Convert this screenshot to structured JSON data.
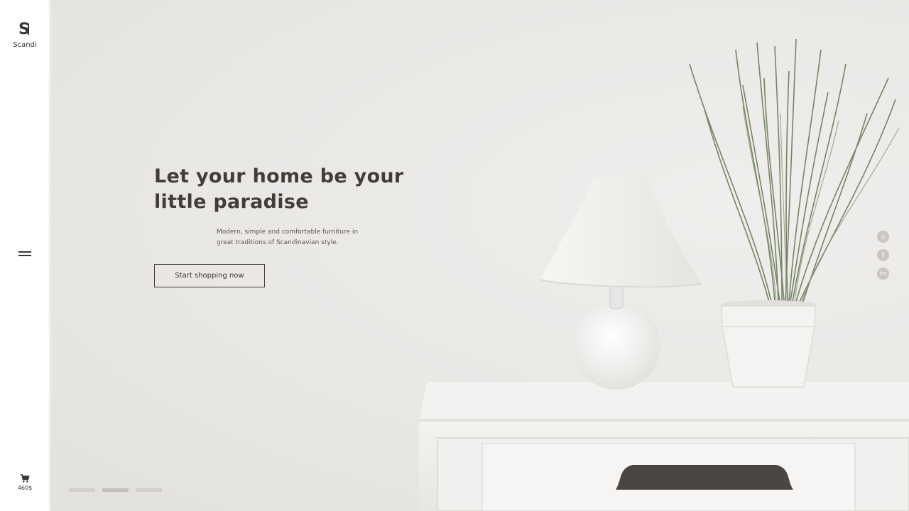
{
  "brand": {
    "name": "Scandi",
    "mark": "S"
  },
  "cart": {
    "total": "460$",
    "icon": "cart-icon"
  },
  "menu": {
    "icon": "hamburger-menu-icon"
  },
  "hero": {
    "headline_line1": "Let your home be your",
    "headline_line2": "little paradise",
    "subtext_line1": "Modern, simple and comfortable furniture in",
    "subtext_line2": "great traditions of Scandinavian style.",
    "cta_label": "Start shopping now"
  },
  "socials": [
    {
      "icon": "instagram-icon",
      "glyph": "◎"
    },
    {
      "icon": "facebook-icon",
      "glyph": "f"
    },
    {
      "icon": "linkedin-icon",
      "glyph": "in"
    }
  ],
  "slider": {
    "count": 3,
    "active_index": 1
  },
  "colors": {
    "accent": "#423d39",
    "background": "#ebe9e6",
    "sidebar": "#ffffff"
  }
}
